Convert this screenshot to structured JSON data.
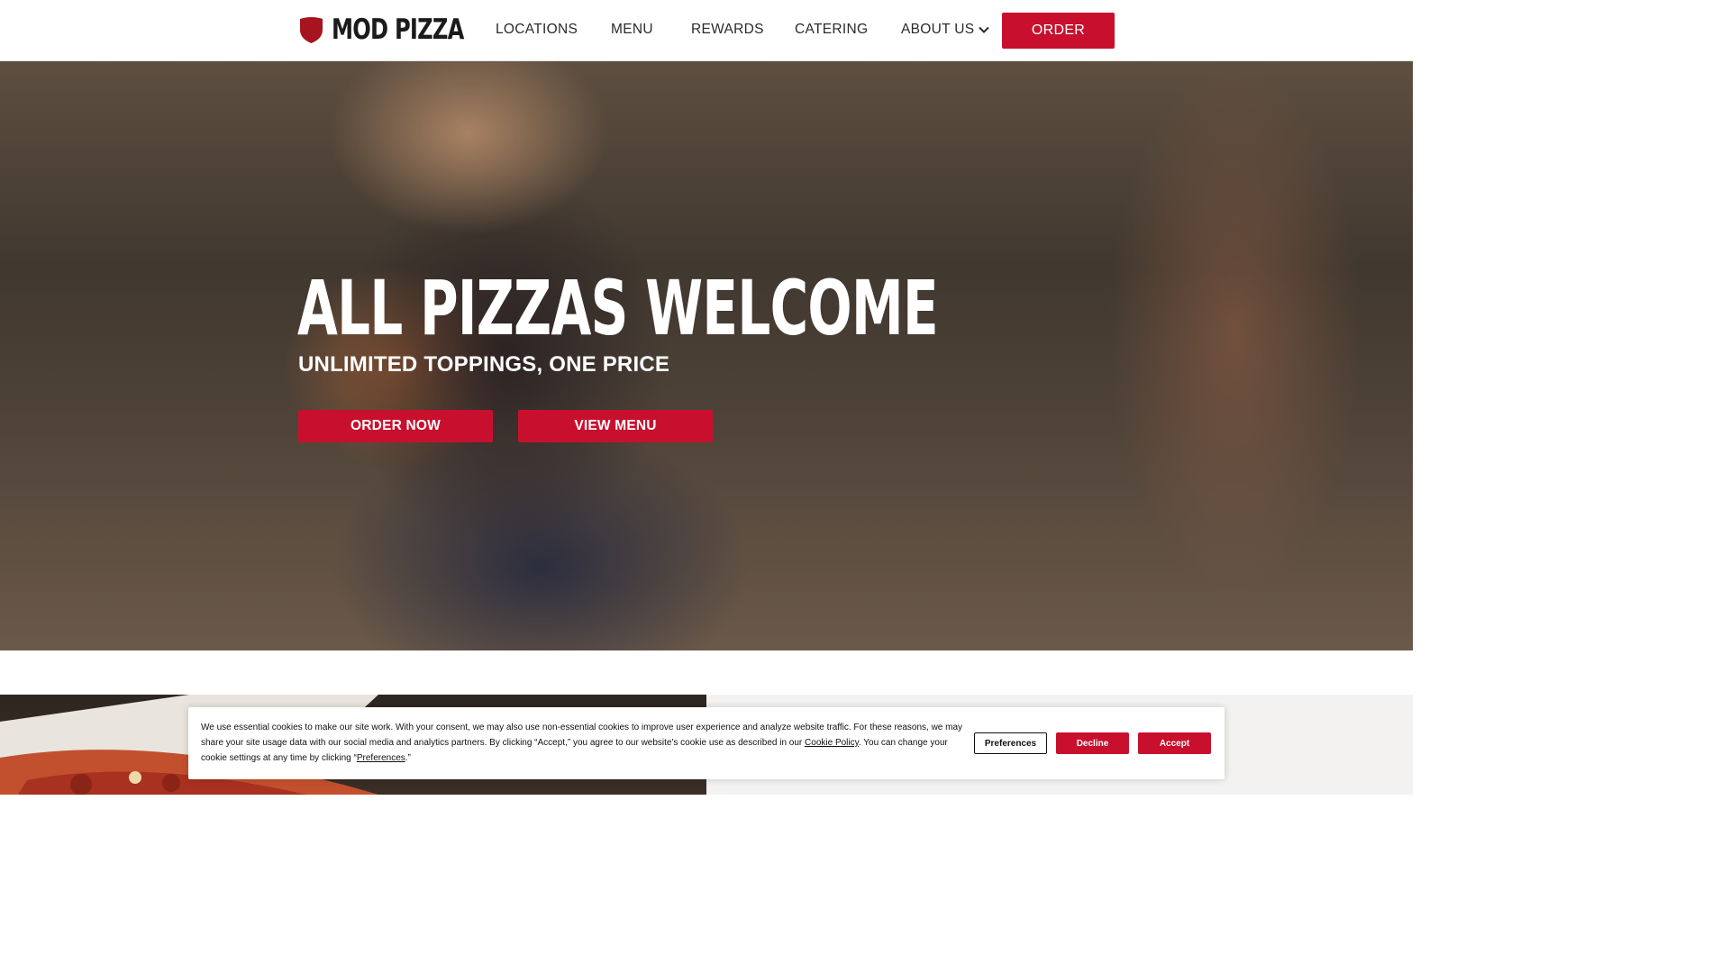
{
  "brand": {
    "name": "MOD PIZZA",
    "logo_icon": "shield-icon",
    "accent_color": "#c8102e"
  },
  "nav": {
    "items": [
      {
        "label": "LOCATIONS"
      },
      {
        "label": "MENU"
      },
      {
        "label": "REWARDS"
      },
      {
        "label": "CATERING"
      },
      {
        "label": "ABOUT US",
        "icon": "chevron-down-icon"
      }
    ],
    "order_label": "ORDER"
  },
  "hero": {
    "title": "ALL PIZZAS WELCOME",
    "subtitle": "UNLIMITED TOPPINGS, ONE PRICE",
    "order_now_label": "ORDER NOW",
    "view_menu_label": "VIEW MENU"
  },
  "cookie": {
    "text_part1": "We use essential cookies to make our site work. With your consent, we may also use non-essential cookies to improve user experience and analyze website traffic. For these reasons, we may share your site usage data with our social media and analytics partners. By clicking “Accept,” you agree to our website's cookie use as described in our ",
    "cookie_policy_link": "Cookie Policy",
    "text_part2": ". You can change your cookie settings at any time by clicking “",
    "preferences_link": "Preferences",
    "text_part3": ".”",
    "preferences_label": "Preferences",
    "decline_label": "Decline",
    "accept_label": "Accept"
  }
}
